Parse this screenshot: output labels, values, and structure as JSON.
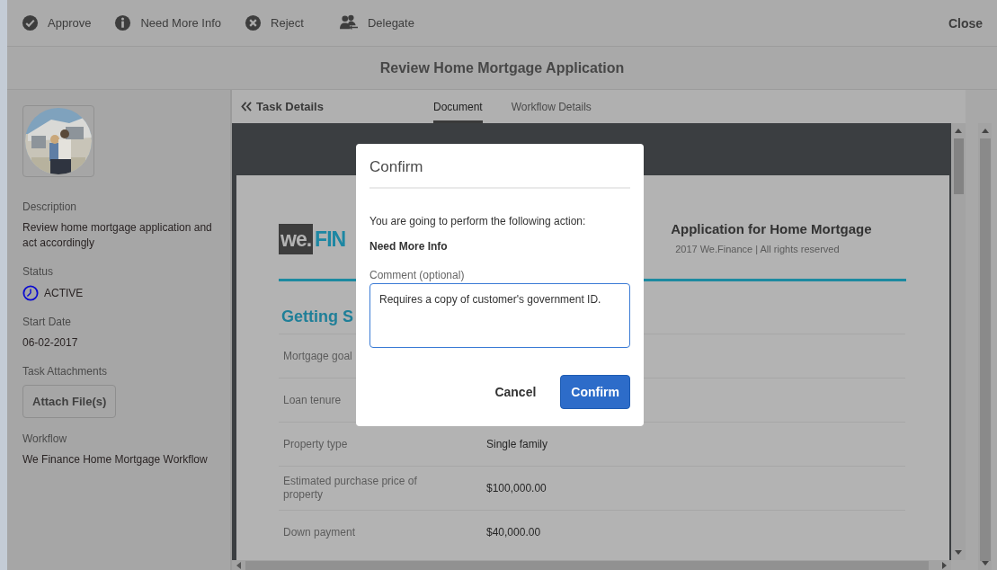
{
  "toolbar": {
    "actions": [
      {
        "label": "Approve",
        "kind": "approve"
      },
      {
        "label": "Need More Info",
        "kind": "info"
      },
      {
        "label": "Reject",
        "kind": "reject"
      },
      {
        "label": "Delegate",
        "kind": "delegate"
      }
    ],
    "close": "Close"
  },
  "window": {
    "title": "Review Home Mortgage Application"
  },
  "sidebar": {
    "fields": [
      {
        "label": "Description",
        "value": "Review home mortgage application and act accordingly",
        "kind": "text"
      },
      {
        "label": "Status",
        "value": "ACTIVE",
        "kind": "status"
      },
      {
        "label": "Start Date",
        "value": "06-02-2017",
        "kind": "text"
      },
      {
        "label": "Task Attachments",
        "value": "Attach File(s)",
        "kind": "button"
      },
      {
        "label": "Workflow",
        "value": "We Finance Home Mortgage Workflow",
        "kind": "text"
      }
    ]
  },
  "panel": {
    "back_link": "Task Details",
    "tabs": [
      {
        "label": "Document",
        "selected": true
      },
      {
        "label": "Workflow Details",
        "selected": false
      }
    ]
  },
  "document": {
    "logo": [
      "we.",
      "FIN"
    ],
    "title": "Application for Home Mortgage",
    "copyright": "2017 We.Finance | All rights reserved",
    "section": "Getting S",
    "rows": [
      {
        "label": "Mortgage goal"
      },
      {
        "label": "Loan tenure"
      },
      {
        "label": "Property type",
        "value": "Single family"
      },
      {
        "label": "Estimated purchase price of property",
        "value": "$100,000.00"
      },
      {
        "label": "Down payment",
        "value": "$40,000.00"
      }
    ]
  },
  "dialog": {
    "title": "Confirm",
    "message": "You are going to perform the following action:",
    "action": "Need More Info",
    "comment_label": "Comment (optional)",
    "comment": "Requires a copy of customer's government ID.",
    "buttons": [
      {
        "label": "Cancel",
        "kind": "secondary"
      },
      {
        "label": "Confirm",
        "kind": "primary"
      }
    ]
  }
}
